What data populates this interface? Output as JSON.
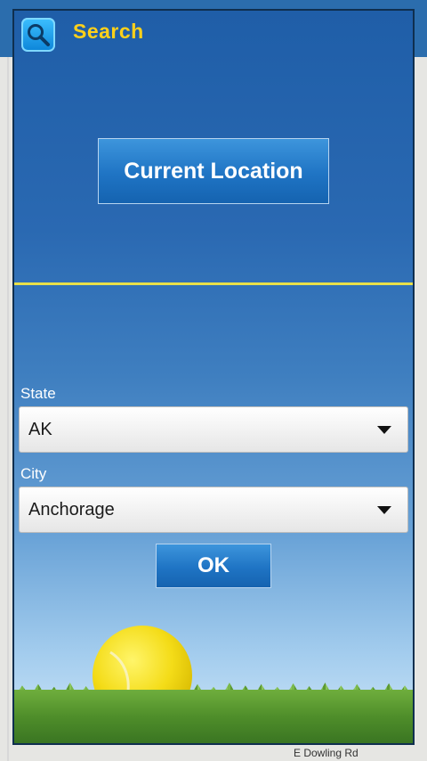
{
  "header": {
    "title": "Search",
    "icon": "search-icon"
  },
  "current_location_label": "Current Location",
  "state": {
    "label": "State",
    "value": "AK"
  },
  "city": {
    "label": "City",
    "value": "Anchorage"
  },
  "ok_label": "OK",
  "map_labels": {
    "street": "E Dowling Rd"
  },
  "colors": {
    "title": "#ffd11a",
    "divider": "#e8e04a",
    "button": "#1f74c4"
  }
}
